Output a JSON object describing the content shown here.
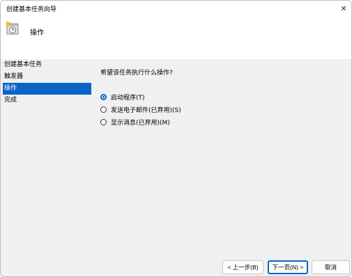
{
  "window": {
    "title": "创建基本任务向导",
    "close_glyph": "✕"
  },
  "header": {
    "title": "操作",
    "icon": "task-scheduler-icon"
  },
  "nav": {
    "items": [
      {
        "label": "创建基本任务",
        "active": false
      },
      {
        "label": "触发器",
        "active": false
      },
      {
        "label": "操作",
        "active": true
      },
      {
        "label": "完成",
        "active": false
      }
    ]
  },
  "content": {
    "question": "希望该任务执行什么操作?",
    "options": [
      {
        "label": "启动程序(T)",
        "checked": true
      },
      {
        "label": "发送电子邮件(已弃用)(S)",
        "checked": false
      },
      {
        "label": "显示消息(已弃用)(M)",
        "checked": false
      }
    ]
  },
  "footer": {
    "prev_label": "< 上一步(B)",
    "next_label": "下一页(N) >",
    "cancel_label": "取消"
  },
  "colors": {
    "accent": "#0a64c8",
    "dialog_bg": "#f0f0f0",
    "header_bg": "#ffffff"
  }
}
